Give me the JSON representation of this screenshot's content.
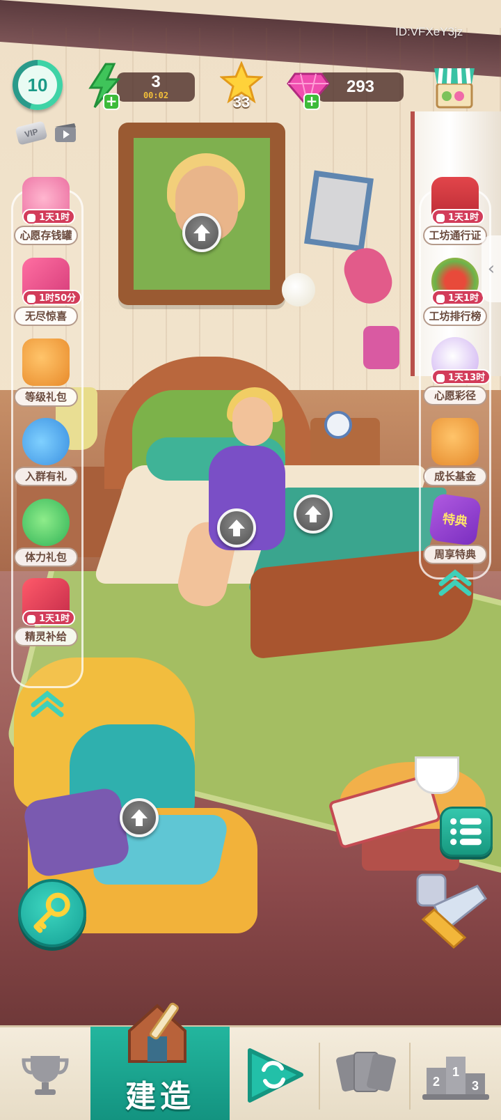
{
  "hud": {
    "player_id": "ID:VFXeY3jz",
    "level": "10",
    "vip_label": "VIP",
    "energy": "3",
    "energy_timer": "00:02",
    "stars": "33",
    "gems": "293",
    "icons": [
      "energy-icon",
      "star-icon",
      "gem-icon",
      "shop-icon",
      "video-icon"
    ]
  },
  "left_events": [
    {
      "label": "心愿存钱罐",
      "timer": "1天1时",
      "icon": "piggy-bank-icon"
    },
    {
      "label": "无尽惊喜",
      "timer": "1时50分",
      "icon": "gift-box-icon"
    },
    {
      "label": "等级礼包",
      "timer": "",
      "icon": "cat-gift-icon"
    },
    {
      "label": "入群有礼",
      "timer": "",
      "icon": "chat-bubbles-icon"
    },
    {
      "label": "体力礼包",
      "timer": "",
      "icon": "green-piggy-icon"
    },
    {
      "label": "精灵补给",
      "timer": "1天1时",
      "icon": "sleigh-gifts-icon"
    }
  ],
  "right_events": [
    {
      "label": "工坊通行证",
      "timer": "1天1时",
      "icon": "workshop-pass-icon"
    },
    {
      "label": "工坊排行榜",
      "timer": "1天1时",
      "icon": "fruit-wreath-icon"
    },
    {
      "label": "心愿彩径",
      "timer": "1天13时",
      "icon": "unicorn-icon"
    },
    {
      "label": "成长基金",
      "timer": "",
      "icon": "cat-fund-icon"
    },
    {
      "label": "周享特典",
      "timer": "",
      "icon": "weekly-ticket-icon"
    }
  ],
  "weekly_ticket_text": "特典",
  "nav": {
    "items": [
      "trophy-icon",
      "build-house-icon",
      "refresh-play-icon",
      "cards-icon",
      "podium-icon"
    ],
    "build_label": "建造",
    "podium_numbers": [
      "2",
      "1",
      "3"
    ]
  },
  "colors": {
    "teal": "#17987f",
    "timer_red": "#d23c5a",
    "label_brown": "#6a4a3d"
  }
}
